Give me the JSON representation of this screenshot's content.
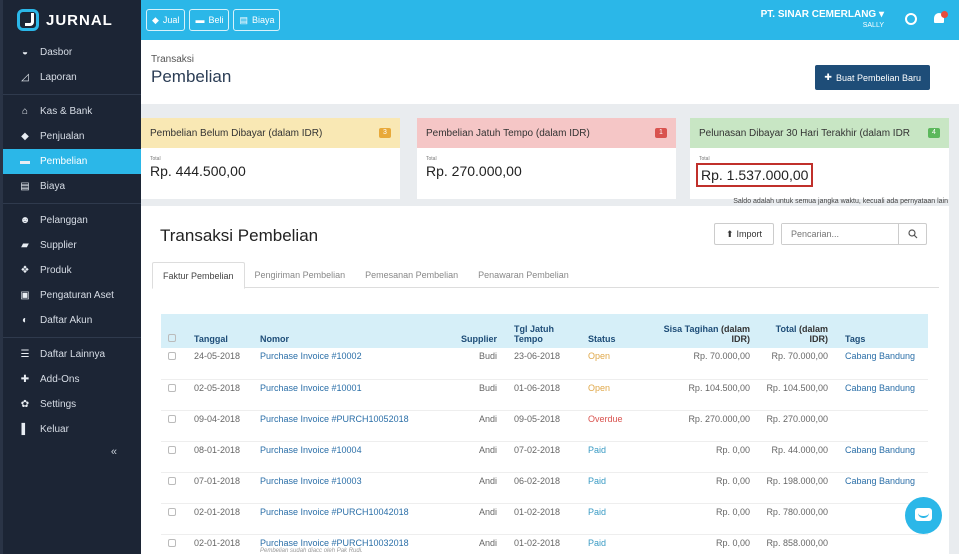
{
  "brand": "JURNAL",
  "sidebar": {
    "items": [
      {
        "label": "Dasbor",
        "icon": "dashboard-icon",
        "glyph": "◒"
      },
      {
        "label": "Laporan",
        "icon": "chart-icon",
        "glyph": "◿"
      },
      {
        "label": "Kas & Bank",
        "icon": "bank-icon",
        "glyph": "⌂"
      },
      {
        "label": "Penjualan",
        "icon": "tag-icon",
        "glyph": "◆"
      },
      {
        "label": "Pembelian",
        "icon": "card-icon",
        "glyph": "▬"
      },
      {
        "label": "Biaya",
        "icon": "document-icon",
        "glyph": "▤"
      },
      {
        "label": "Pelanggan",
        "icon": "users-icon",
        "glyph": "☻"
      },
      {
        "label": "Supplier",
        "icon": "truck-icon",
        "glyph": "▰"
      },
      {
        "label": "Produk",
        "icon": "cube-icon",
        "glyph": "❖"
      },
      {
        "label": "Pengaturan Aset",
        "icon": "asset-icon",
        "glyph": "▣"
      },
      {
        "label": "Daftar Akun",
        "icon": "book-icon",
        "glyph": "◐"
      },
      {
        "label": "Daftar Lainnya",
        "icon": "list-icon",
        "glyph": "☰"
      },
      {
        "label": "Add-Ons",
        "icon": "addon-icon",
        "glyph": "✚"
      },
      {
        "label": "Settings",
        "icon": "settings-icon",
        "glyph": "✿"
      },
      {
        "label": "Keluar",
        "icon": "logout-icon",
        "glyph": "▌"
      }
    ],
    "collapse": "«"
  },
  "topbar": {
    "jual": "Jual",
    "beli": "Beli",
    "biaya": "Biaya",
    "company": "PT. SINAR CEMERLANG ▾",
    "user": "SALLY"
  },
  "header": {
    "breadcrumb": "Transaksi",
    "title": "Pembelian",
    "new_button": "Buat Pembelian Baru"
  },
  "cards": [
    {
      "title": "Pembelian Belum Dibayar (dalam IDR)",
      "total_label": "Total",
      "total": "Rp. 444.500,00",
      "color": "#f9e8b4",
      "badge": "#e8a93a",
      "badge_text": "3"
    },
    {
      "title": "Pembelian Jatuh Tempo (dalam IDR)",
      "total_label": "Total",
      "total": "Rp. 270.000,00",
      "color": "#f5c6c6",
      "badge": "#d9534f",
      "badge_text": "1"
    },
    {
      "title": "Pelunasan Dibayar 30 Hari Terakhir (dalam IDR",
      "total_label": "Total",
      "total": "Rp. 1.537.000,00",
      "color": "#c8e6c4",
      "badge": "#5cb85c",
      "badge_text": "4"
    }
  ],
  "disclaimer": "Saldo adalah untuk semua jangka waktu, kecuali ada pernyataan lain",
  "section": {
    "title": "Transaksi Pembelian",
    "import": "Import",
    "search_placeholder": "Pencarian..."
  },
  "tabs": [
    "Faktur Pembelian",
    "Pengiriman Pembelian",
    "Pemesanan Pembelian",
    "Penawaran Pembelian"
  ],
  "table": {
    "headers": {
      "tanggal": "Tanggal",
      "nomor": "Nomor",
      "supplier": "Supplier",
      "jatuh_tempo": "Tgl Jatuh Tempo",
      "status": "Status",
      "sisa_a": "Sisa Tagihan",
      "sisa_b": " (dalam IDR)",
      "total_a": "Total",
      "total_b": " (dalam IDR)",
      "tags": "Tags"
    },
    "rows": [
      {
        "tanggal": "24-05-2018",
        "nomor": "Purchase Invoice #10002",
        "supplier": "Budi",
        "tempo": "23-06-2018",
        "status": "Open",
        "sisa": "Rp. 70.000,00",
        "total": "Rp. 70.000,00",
        "tags": "Cabang Bandung",
        "note": ""
      },
      {
        "tanggal": "02-05-2018",
        "nomor": "Purchase Invoice #10001",
        "supplier": "Budi",
        "tempo": "01-06-2018",
        "status": "Open",
        "sisa": "Rp. 104.500,00",
        "total": "Rp. 104.500,00",
        "tags": "Cabang Bandung",
        "note": ""
      },
      {
        "tanggal": "09-04-2018",
        "nomor": "Purchase Invoice #PURCH10052018",
        "supplier": "Andi",
        "tempo": "09-05-2018",
        "status": "Overdue",
        "sisa": "Rp. 270.000,00",
        "total": "Rp. 270.000,00",
        "tags": "",
        "note": ""
      },
      {
        "tanggal": "08-01-2018",
        "nomor": "Purchase Invoice #10004",
        "supplier": "Andi",
        "tempo": "07-02-2018",
        "status": "Paid",
        "sisa": "Rp. 0,00",
        "total": "Rp. 44.000,00",
        "tags": "Cabang Bandung",
        "note": ""
      },
      {
        "tanggal": "07-01-2018",
        "nomor": "Purchase Invoice #10003",
        "supplier": "Andi",
        "tempo": "06-02-2018",
        "status": "Paid",
        "sisa": "Rp. 0,00",
        "total": "Rp. 198.000,00",
        "tags": "Cabang Bandung",
        "note": ""
      },
      {
        "tanggal": "02-01-2018",
        "nomor": "Purchase Invoice #PURCH10042018",
        "supplier": "Andi",
        "tempo": "01-02-2018",
        "status": "Paid",
        "sisa": "Rp. 0,00",
        "total": "Rp. 780.000,00",
        "tags": "",
        "note": ""
      },
      {
        "tanggal": "02-01-2018",
        "nomor": "Purchase Invoice #PURCH10032018",
        "supplier": "Andi",
        "tempo": "01-02-2018",
        "status": "Paid",
        "sisa": "Rp. 0,00",
        "total": "Rp. 858.000,00",
        "tags": "",
        "note": "Pembelian sudah diacc oleh Pak Rudi."
      }
    ]
  },
  "colors": {
    "accent": "#2bb7e8",
    "sidebar": "#1c2535",
    "primary_button": "#1e4d78"
  }
}
